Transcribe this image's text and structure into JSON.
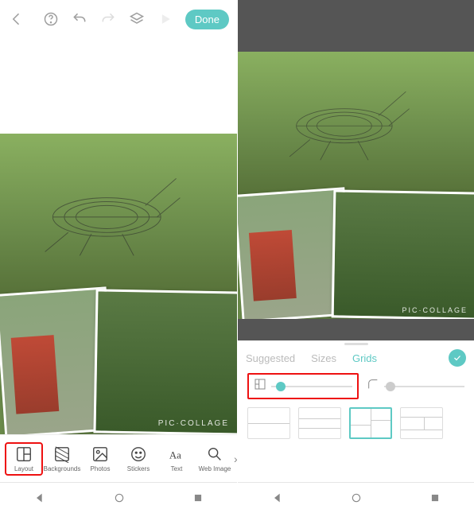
{
  "left": {
    "topbar": {
      "done": "Done"
    },
    "watermark": "PIC·COLLAGE",
    "tools": [
      {
        "key": "layout",
        "label": "Layout",
        "icon": "layout-icon",
        "highlighted": true
      },
      {
        "key": "backgrounds",
        "label": "Backgrounds",
        "icon": "backgrounds-icon",
        "highlighted": false
      },
      {
        "key": "photos",
        "label": "Photos",
        "icon": "photos-icon",
        "highlighted": false
      },
      {
        "key": "stickers",
        "label": "Stickers",
        "icon": "stickers-icon",
        "highlighted": false
      },
      {
        "key": "text",
        "label": "Text",
        "icon": "text-icon",
        "highlighted": false
      },
      {
        "key": "webimage",
        "label": "Web Image",
        "icon": "search-icon",
        "highlighted": false
      }
    ]
  },
  "right": {
    "tabs": [
      {
        "key": "suggested",
        "label": "Suggested",
        "active": false
      },
      {
        "key": "sizes",
        "label": "Sizes",
        "active": false
      },
      {
        "key": "grids",
        "label": "Grids",
        "active": true
      }
    ],
    "sliders": {
      "border": {
        "icon": "border-width-icon",
        "value": 0.06,
        "highlighted": true
      },
      "corner": {
        "icon": "corner-radius-icon",
        "value": 0.02,
        "highlighted": false
      }
    },
    "grid_options_count": 4,
    "grid_selected_index": 2,
    "watermark": "PIC·COLLAGE"
  },
  "colors": {
    "accent": "#5ec9c4",
    "highlight_box": "#e11"
  }
}
